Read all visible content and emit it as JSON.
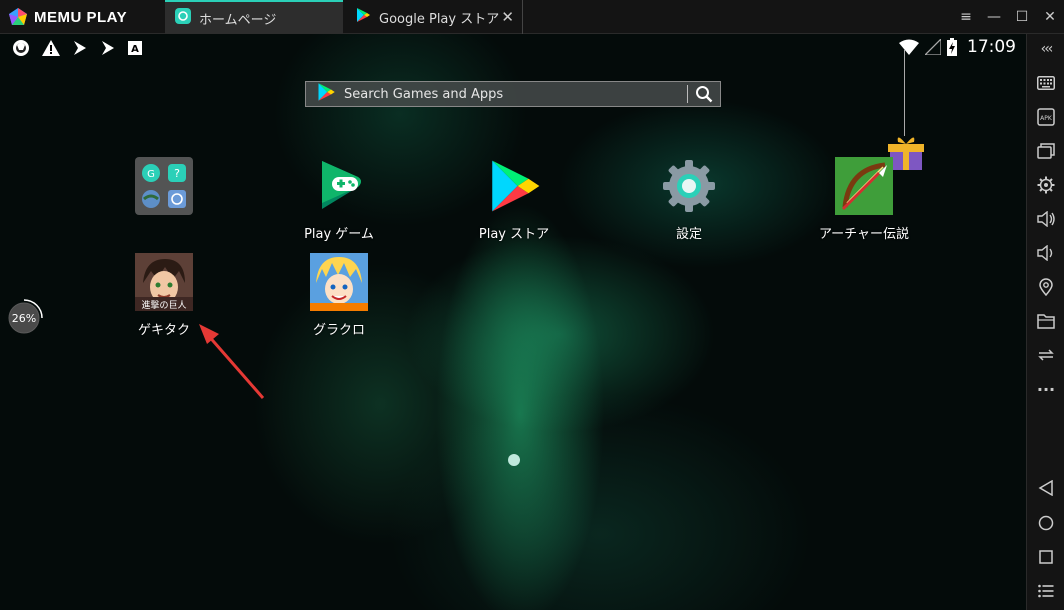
{
  "app": {
    "logo_text": "MEMU PLAY"
  },
  "tabs": [
    {
      "label": "ホームページ",
      "active": true
    },
    {
      "label": "Google Play ストア",
      "active": false
    }
  ],
  "window_controls": {
    "menu": "≡",
    "minimize": "—",
    "maximize": "☐",
    "close": "✕"
  },
  "status_bar": {
    "time": "17:09"
  },
  "search": {
    "placeholder": "Search Games and Apps"
  },
  "apps": [
    {
      "label": ""
    },
    {
      "label": "Play ゲーム"
    },
    {
      "label": "Play ストア"
    },
    {
      "label": "設定"
    },
    {
      "label": "アーチャー伝説"
    },
    {
      "label": "ゲキタク"
    },
    {
      "label": "グラクロ"
    }
  ],
  "overlay": {
    "progress_text": "26%",
    "progress_value": 26
  },
  "sidebar": {
    "collapse_label": "‹‹‹",
    "more_label": "···"
  },
  "colors": {
    "accent": "#2bd0b8",
    "titlebar": "#141414",
    "arrow": "#e53935"
  }
}
